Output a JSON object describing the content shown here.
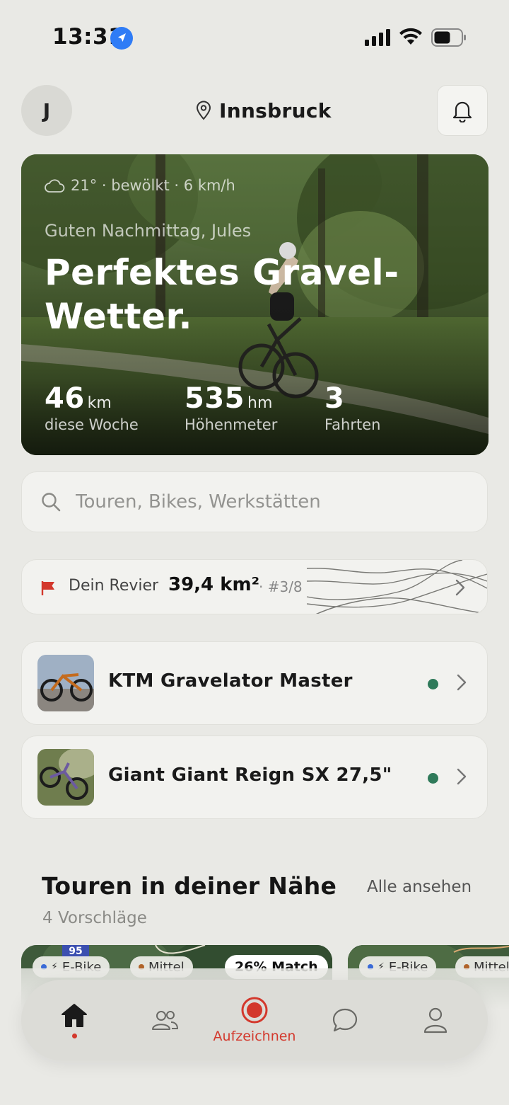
{
  "status_bar": {
    "time": "13:31"
  },
  "header": {
    "avatar_initial": "J",
    "location": "Innsbruck"
  },
  "hero": {
    "weather": "21° · bewölkt · 6 km/h",
    "greeting": "Guten Nachmittag, Jules",
    "title": "Perfektes Gravel-Wetter.",
    "stats": [
      {
        "value": "46",
        "unit": "km",
        "label": "diese Woche"
      },
      {
        "value": "535",
        "unit": "hm",
        "label": "Höhenmeter"
      },
      {
        "value": "3",
        "unit": "",
        "label": "Fahrten"
      }
    ]
  },
  "search": {
    "placeholder": "Touren, Bikes, Werkstätten"
  },
  "revier": {
    "label": "Dein Revier",
    "area": "39,4 km²",
    "rank": "· #3/8"
  },
  "bikes": [
    {
      "name": "KTM Gravelator Master"
    },
    {
      "name": "Giant Giant Reign SX 27,5\""
    }
  ],
  "tours_section": {
    "title": "Touren in deiner Nähe",
    "link": "Alle ansehen",
    "subtitle": "4 Vorschläge"
  },
  "tour_cards": [
    {
      "road_badge": "95",
      "chips": [
        "E-Bike",
        "Mittel"
      ],
      "match": "26% Match"
    },
    {
      "chips": [
        "E-Bike",
        "Mittel"
      ]
    }
  ],
  "tabbar": {
    "record_label": "Aufzeichnen"
  },
  "colors": {
    "accent_red": "#d3382c",
    "status_green": "#2f7a5a",
    "background": "#e9e9e5"
  }
}
